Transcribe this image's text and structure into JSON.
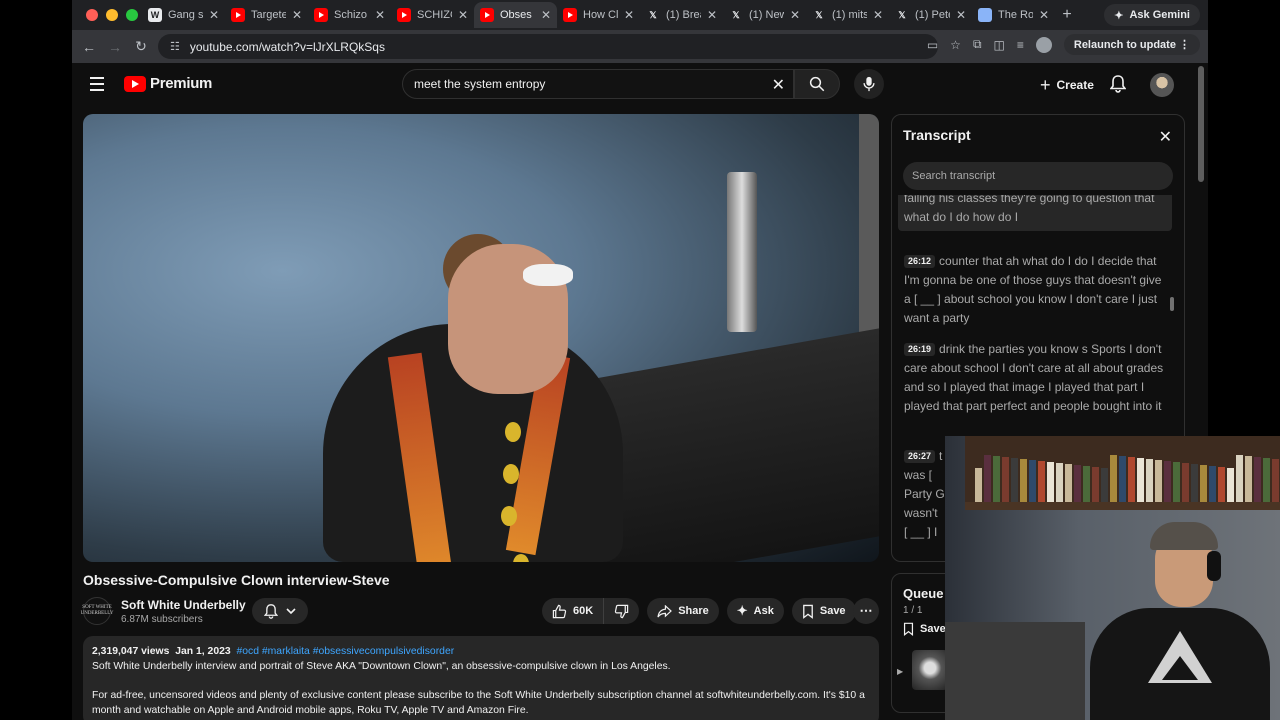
{
  "browser": {
    "tabs": [
      {
        "label": "Gang s",
        "icon": "wikipedia-icon",
        "active": false
      },
      {
        "label": "Targete",
        "icon": "youtube-icon",
        "active": false
      },
      {
        "label": "Schizo",
        "icon": "youtube-icon",
        "active": false
      },
      {
        "label": "SCHIZO",
        "icon": "youtube-icon",
        "active": false
      },
      {
        "label": "Obses",
        "icon": "youtube-icon",
        "active": true
      },
      {
        "label": "How Cl",
        "icon": "youtube-icon",
        "active": false
      },
      {
        "label": "(1) Brea",
        "icon": "x-icon",
        "active": false
      },
      {
        "label": "(1) New",
        "icon": "x-icon",
        "active": false
      },
      {
        "label": "(1) mits",
        "icon": "x-icon",
        "active": false
      },
      {
        "label": "(1) Pete",
        "icon": "x-icon",
        "active": false
      },
      {
        "label": "The Ro",
        "icon": "doc-icon",
        "active": false
      }
    ],
    "gemini_label": "Ask Gemini",
    "url": "youtube.com/watch?v=lJrXLRQkSqs",
    "relaunch_label": "Relaunch to update"
  },
  "youtube": {
    "logo_text": "Premium",
    "search_value": "meet the system entropy",
    "create_label": "Create",
    "video": {
      "title": "Obsessive-Compulsive Clown interview-Steve",
      "channel": "Soft White Underbelly",
      "channel_avatar_text": "SOFT WHITE UNDERBELLY",
      "subscribers": "6.87M subscribers",
      "likes": "60K",
      "share_label": "Share",
      "ask_label": "Ask",
      "save_label": "Save"
    },
    "description": {
      "views": "2,319,047 views",
      "date": "Jan 1, 2023",
      "tags": "#ocd #marklaita #obsessivecompulsivedisorder",
      "line1": "Soft White Underbelly interview and portrait of Steve AKA \"Downtown Clown\", an obsessive-compulsive clown in Los Angeles.",
      "line2": "For ad-free, uncensored videos and plenty of exclusive content please subscribe to the Soft White Underbelly subscription channel at softwhiteunderbelly.com. It's $10 a",
      "line3": "month and watchable on Apple and Android mobile apps, Roku TV, Apple TV and Amazon Fire."
    },
    "transcript": {
      "title": "Transcript",
      "search_placeholder": "Search transcript",
      "segments": [
        {
          "time": "",
          "text": "failing his classes they're going to question that what do I do how do I"
        },
        {
          "time": "26:12",
          "text": "counter that ah what do I do I decide that I'm gonna be one of those guys that doesn't give a [ __ ] about school you know I don't care I just want a party"
        },
        {
          "time": "26:19",
          "text": "drink the parties you know s Sports I don't care about school I don't care at all about grades and so I played that image I played that part I played that part perfect and people bought into it"
        },
        {
          "time": "26:27",
          "text": "t"
        },
        {
          "time": "",
          "text": "was ["
        },
        {
          "time": "",
          "text": "Party G"
        },
        {
          "time": "",
          "text": "wasn't"
        },
        {
          "time": "",
          "text": "[ __ ] I"
        }
      ]
    },
    "queue": {
      "title": "Queue",
      "count": "1 / 1",
      "save_label": "Save"
    }
  }
}
